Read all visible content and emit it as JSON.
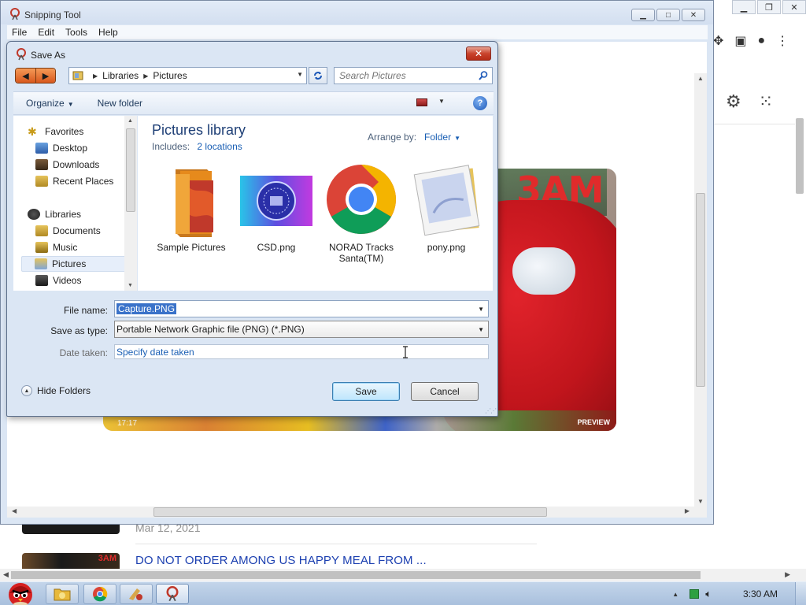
{
  "browser": {
    "feed": {
      "date": "Mar 12, 2021",
      "title": "DO NOT ORDER AMONG US HAPPY MEAL FROM ...",
      "thumb_badge": "3AM"
    }
  },
  "snipping_tool": {
    "title": "Snipping Tool",
    "menu": [
      "File",
      "Edit",
      "Tools",
      "Help"
    ],
    "video": {
      "overlay_text": "3AM",
      "duration": "17:17",
      "preview": "PREVIEW"
    }
  },
  "save_dialog": {
    "title": "Save As",
    "address": {
      "segments": [
        "Libraries",
        "Pictures"
      ]
    },
    "search": {
      "placeholder": "Search Pictures"
    },
    "toolbar": {
      "organize": "Organize",
      "new_folder": "New folder"
    },
    "nav": {
      "favorites": "Favorites",
      "favorites_items": [
        "Desktop",
        "Downloads",
        "Recent Places"
      ],
      "libraries": "Libraries",
      "libraries_items": [
        "Documents",
        "Music",
        "Pictures",
        "Videos"
      ],
      "selected": "Pictures"
    },
    "library": {
      "title": "Pictures library",
      "includes_label": "Includes:",
      "includes_link": "2 locations",
      "arrange_label": "Arrange by:",
      "arrange_value": "Folder"
    },
    "files": [
      {
        "name": "Sample Pictures"
      },
      {
        "name": "CSD.png"
      },
      {
        "name": "NORAD Tracks Santa(TM)"
      },
      {
        "name": "pony.png"
      }
    ],
    "form": {
      "file_name_label": "File name:",
      "file_name_value": "Capture.PNG",
      "save_type_label": "Save as type:",
      "save_type_value": "Portable Network Graphic file (PNG) (*.PNG)",
      "date_label": "Date taken:",
      "date_value": "Specify date taken"
    },
    "hide_folders": "Hide Folders",
    "buttons": {
      "save": "Save",
      "cancel": "Cancel"
    }
  },
  "taskbar": {
    "clock": "3:30 AM"
  },
  "colors": {
    "accent_blue": "#1a5fb4",
    "dialog_bg": "#dbe6f4",
    "close_red": "#c9442d",
    "selection": "#3a72c9"
  }
}
